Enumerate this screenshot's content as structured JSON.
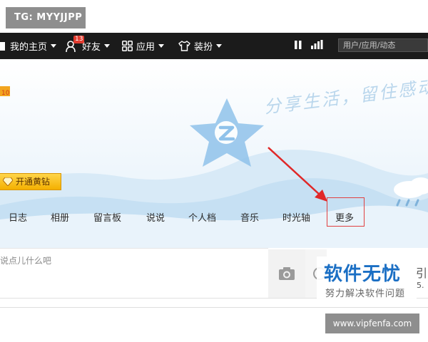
{
  "watermark_tag": "TG: MYYJJPP",
  "topbar": {
    "home_label": "我的主页",
    "friends_label": "好友",
    "friends_badge": "13",
    "apps_label": "应用",
    "dress_label": "装扮",
    "search_placeholder": "用户/应用/动态"
  },
  "cover": {
    "slogan": "分享生活，留住感动",
    "vip_label": "开通黄钻"
  },
  "tabs": [
    "日志",
    "相册",
    "留言板",
    "说说",
    "个人档",
    "音乐",
    "时光轴",
    "更多"
  ],
  "post": {
    "placeholder": "说点儿什么吧"
  },
  "watermark": {
    "title": "软件无忧",
    "subtitle": "努力解决软件问题",
    "side_char": "引",
    "side_num": "5.",
    "url": "www.vipfenfa.com"
  },
  "colors": {
    "topbar_bg": "#1b1b1b",
    "accent_blue": "#1b6fc4",
    "highlight_red": "#e04040",
    "vip_gold": "#f4b000"
  }
}
